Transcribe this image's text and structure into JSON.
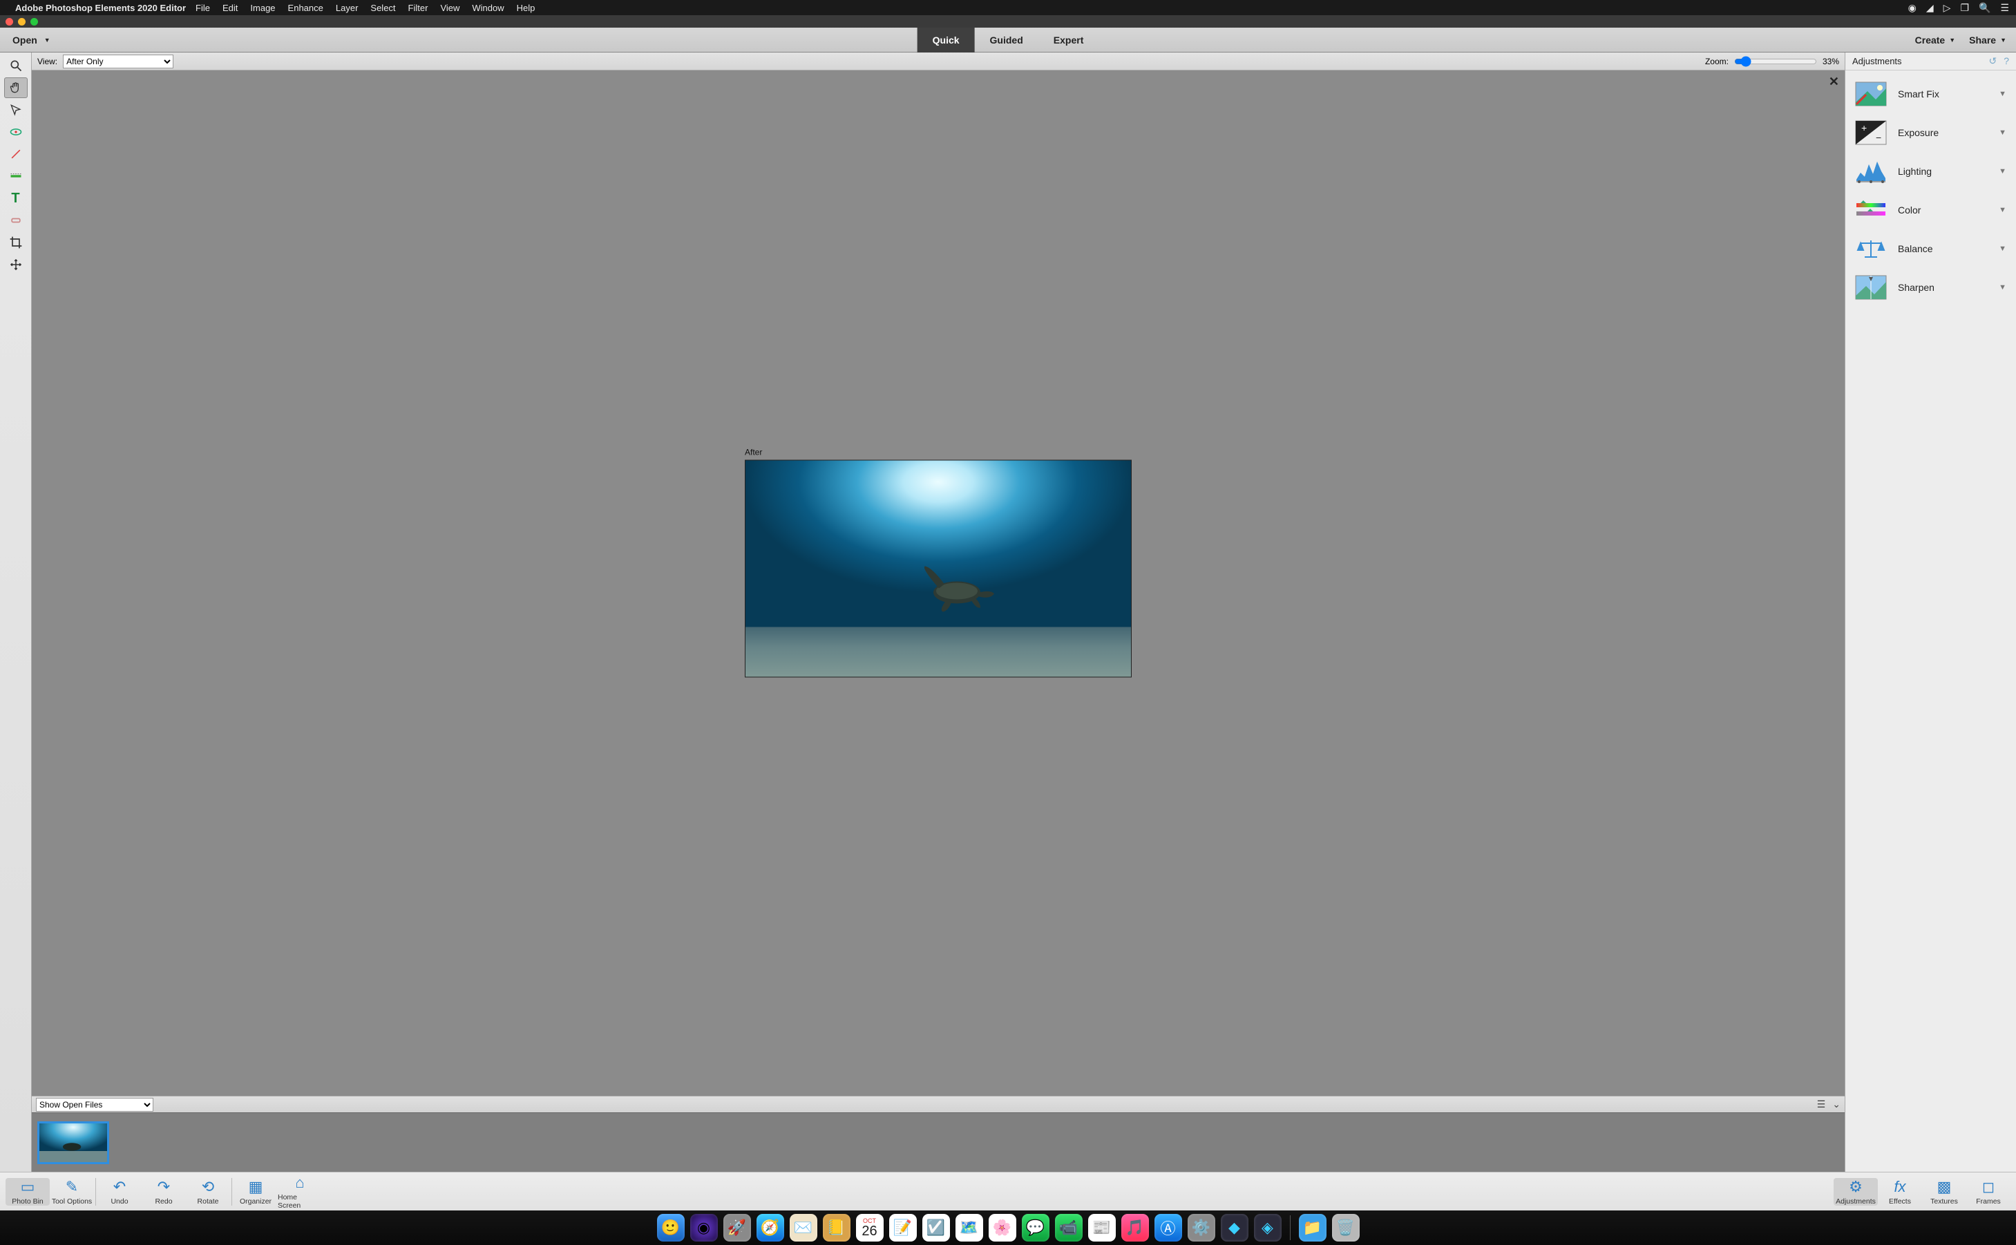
{
  "menubar": {
    "app_name": "Adobe Photoshop Elements 2020 Editor",
    "items": [
      "File",
      "Edit",
      "Image",
      "Enhance",
      "Layer",
      "Select",
      "Filter",
      "View",
      "Window",
      "Help"
    ]
  },
  "topbar": {
    "open_label": "Open",
    "modes": {
      "quick": "Quick",
      "guided": "Guided",
      "expert": "Expert",
      "active": "quick"
    },
    "create_label": "Create",
    "share_label": "Share"
  },
  "viewbar": {
    "view_label": "View:",
    "view_value": "After Only",
    "zoom_label": "Zoom:",
    "zoom_value": "33%"
  },
  "canvas": {
    "after_label": "After"
  },
  "photobin": {
    "select_value": "Show Open Files"
  },
  "adjustments_panel": {
    "title": "Adjustments",
    "items": [
      {
        "key": "smartfix",
        "label": "Smart Fix"
      },
      {
        "key": "exposure",
        "label": "Exposure"
      },
      {
        "key": "lighting",
        "label": "Lighting"
      },
      {
        "key": "color",
        "label": "Color"
      },
      {
        "key": "balance",
        "label": "Balance"
      },
      {
        "key": "sharpen",
        "label": "Sharpen"
      }
    ]
  },
  "bottom_bar": {
    "left": [
      {
        "key": "photobin",
        "label": "Photo Bin"
      },
      {
        "key": "tooloptions",
        "label": "Tool Options"
      },
      {
        "key": "undo",
        "label": "Undo"
      },
      {
        "key": "redo",
        "label": "Redo"
      },
      {
        "key": "rotate",
        "label": "Rotate"
      },
      {
        "key": "organizer",
        "label": "Organizer"
      },
      {
        "key": "homescreen",
        "label": "Home Screen"
      }
    ],
    "right": [
      {
        "key": "adjustments_btn",
        "label": "Adjustments"
      },
      {
        "key": "effects",
        "label": "Effects"
      },
      {
        "key": "textures",
        "label": "Textures"
      },
      {
        "key": "frames",
        "label": "Frames"
      }
    ]
  },
  "dock": {
    "date_month": "OCT",
    "date_day": "26"
  }
}
